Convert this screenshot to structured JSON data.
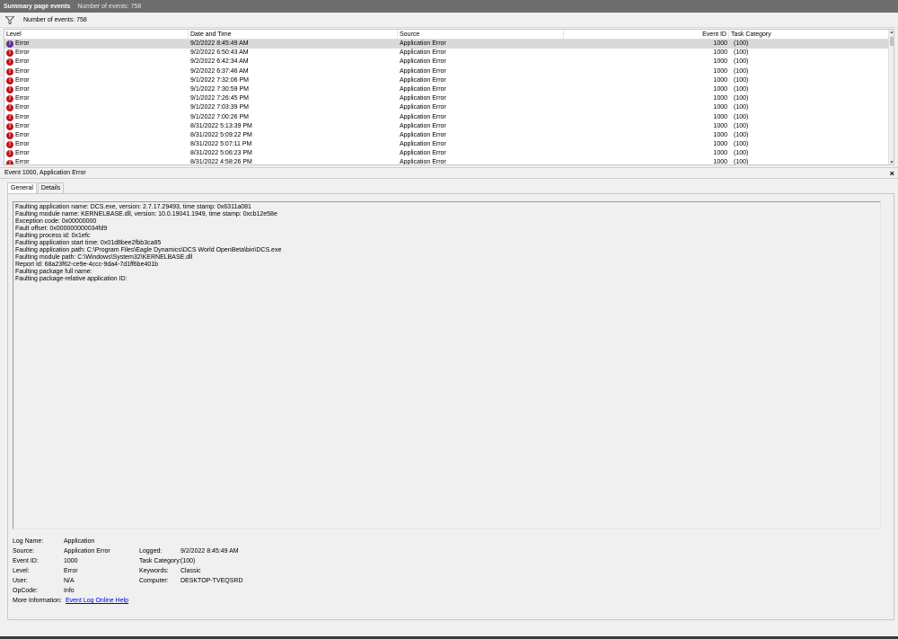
{
  "title_bar": {
    "title": "Summary page events",
    "count": "Number of events: 758"
  },
  "filter_bar": {
    "icon": "filter-icon",
    "count_text": "Number of events: 758"
  },
  "table": {
    "columns": [
      "Level",
      "Date and Time",
      "Source",
      "Event ID",
      "Task Category"
    ],
    "rows": [
      {
        "level": "Error",
        "date": "9/2/2022 8:45:49 AM",
        "source": "Application Error",
        "event_id": "1000",
        "category": "(100)",
        "selected": true
      },
      {
        "level": "Error",
        "date": "9/2/2022 6:50:43 AM",
        "source": "Application Error",
        "event_id": "1000",
        "category": "(100)"
      },
      {
        "level": "Error",
        "date": "9/2/2022 6:42:34 AM",
        "source": "Application Error",
        "event_id": "1000",
        "category": "(100)"
      },
      {
        "level": "Error",
        "date": "9/2/2022 6:37:46 AM",
        "source": "Application Error",
        "event_id": "1000",
        "category": "(100)"
      },
      {
        "level": "Error",
        "date": "9/1/2022 7:32:06 PM",
        "source": "Application Error",
        "event_id": "1000",
        "category": "(100)"
      },
      {
        "level": "Error",
        "date": "9/1/2022 7:30:59 PM",
        "source": "Application Error",
        "event_id": "1000",
        "category": "(100)"
      },
      {
        "level": "Error",
        "date": "9/1/2022 7:26:45 PM",
        "source": "Application Error",
        "event_id": "1000",
        "category": "(100)"
      },
      {
        "level": "Error",
        "date": "9/1/2022 7:03:39 PM",
        "source": "Application Error",
        "event_id": "1000",
        "category": "(100)"
      },
      {
        "level": "Error",
        "date": "9/1/2022 7:00:26 PM",
        "source": "Application Error",
        "event_id": "1000",
        "category": "(100)"
      },
      {
        "level": "Error",
        "date": "8/31/2022 5:13:39 PM",
        "source": "Application Error",
        "event_id": "1000",
        "category": "(100)"
      },
      {
        "level": "Error",
        "date": "8/31/2022 5:09:22 PM",
        "source": "Application Error",
        "event_id": "1000",
        "category": "(100)"
      },
      {
        "level": "Error",
        "date": "8/31/2022 5:07:11 PM",
        "source": "Application Error",
        "event_id": "1000",
        "category": "(100)"
      },
      {
        "level": "Error",
        "date": "8/31/2022 5:06:23 PM",
        "source": "Application Error",
        "event_id": "1000",
        "category": "(100)"
      },
      {
        "level": "Error",
        "date": "8/31/2022 4:58:26 PM",
        "source": "Application Error",
        "event_id": "1000",
        "category": "(100)"
      }
    ]
  },
  "detail": {
    "header": "Event 1000, Application Error",
    "close_glyph": "×",
    "tabs": [
      "General",
      "Details"
    ],
    "description": [
      "Faulting application name: DCS.exe, version: 2.7.17.29493, time stamp: 0x6311a081",
      "Faulting module name: KERNELBASE.dll, version: 10.0.19041.1949, time stamp: 0xcb12e58e",
      "Exception code: 0x00000000",
      "Fault offset: 0x000000000034fd9",
      "Faulting process id: 0x1efc",
      "Faulting application start time: 0x01d8bee2fbb3ca85",
      "Faulting application path: C:\\Program Files\\Eagle Dynamics\\DCS World OpenBeta\\bin\\DCS.exe",
      "Faulting module path: C:\\Windows\\System32\\KERNELBASE.dll",
      "Report Id: 68a23f62-ce9e-4ccc-9da4-7d1ff6be401b",
      "Faulting package full name:",
      "Faulting package-relative application ID:"
    ],
    "props": {
      "log_name_label": "Log Name:",
      "log_name": "Application",
      "source_label": "Source:",
      "source": "Application Error",
      "logged_label": "Logged:",
      "logged": "9/2/2022 8:45:49 AM",
      "event_id_label": "Event ID:",
      "event_id": "1000",
      "task_category_label": "Task Category:",
      "task_category": "(100)",
      "level_label": "Level:",
      "level": "Error",
      "keywords_label": "Keywords:",
      "keywords": "Classic",
      "user_label": "User:",
      "user": "N/A",
      "computer_label": "Computer:",
      "computer": "DESKTOP-TVEQSRD",
      "opcode_label": "OpCode:",
      "opcode": "Info",
      "more_info_label": "More Information:",
      "more_info_link": "Event Log Online Help"
    }
  }
}
